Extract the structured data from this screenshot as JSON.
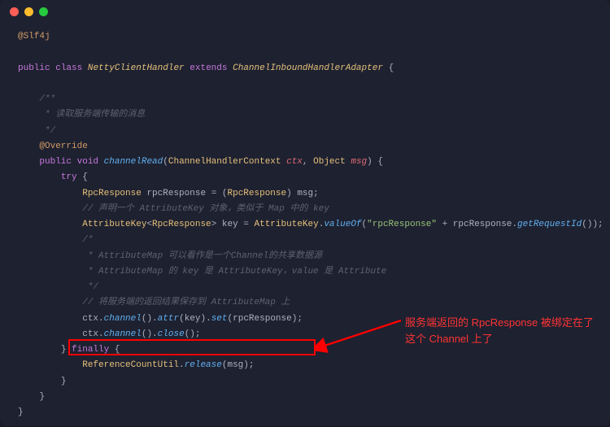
{
  "code": {
    "annotation_slf4j": "@Slf4j",
    "public": "public",
    "class": "class",
    "class_name": "NettyClientHandler",
    "extends": "extends",
    "parent_class": "ChannelInboundHandlerAdapter",
    "comment_open": "/**",
    "comment_read": " * 读取服务端传输的消息",
    "comment_close": " */",
    "override": "@Override",
    "void": "void",
    "method_name": "channelRead",
    "param_type1": "ChannelHandlerContext",
    "param_name1": "ctx",
    "param_type2": "Object",
    "param_name2": "msg",
    "try": "try",
    "rpc_response_type": "RpcResponse",
    "rpc_response_var": "rpcResponse",
    "cast_type": "RpcResponse",
    "msg_var": "msg",
    "comment_attr_key": "// 声明一个 AttributeKey 对象，类似于 Map 中的 key",
    "attr_key_type": "AttributeKey",
    "generic_type": "RpcResponse",
    "key_var": "key",
    "attr_key_class": "AttributeKey",
    "value_of": "valueOf",
    "string_rpc": "\"rpcResponse\"",
    "plus": " + ",
    "get_request_id": "getRequestId",
    "comment_star_open": "/*",
    "comment_attrmap1": " * AttributeMap 可以看作是一个Channel的共享数据源",
    "comment_attrmap2": " * AttributeMap 的 key 是 AttributeKey，value 是 Attribute",
    "comment_star_close": " */",
    "comment_save": "// 将服务端的返回结果保存到 AttributeMap 上",
    "ctx_var": "ctx",
    "channel_method": "channel",
    "attr_method": "attr",
    "set_method": "set",
    "close_method": "close",
    "finally": "finally",
    "ref_count_util": "ReferenceCountUtil",
    "release_method": "release"
  },
  "annotation": {
    "line1": "服务端返回的 RpcResponse 被绑定在了",
    "line2": "这个 Channel 上了"
  }
}
